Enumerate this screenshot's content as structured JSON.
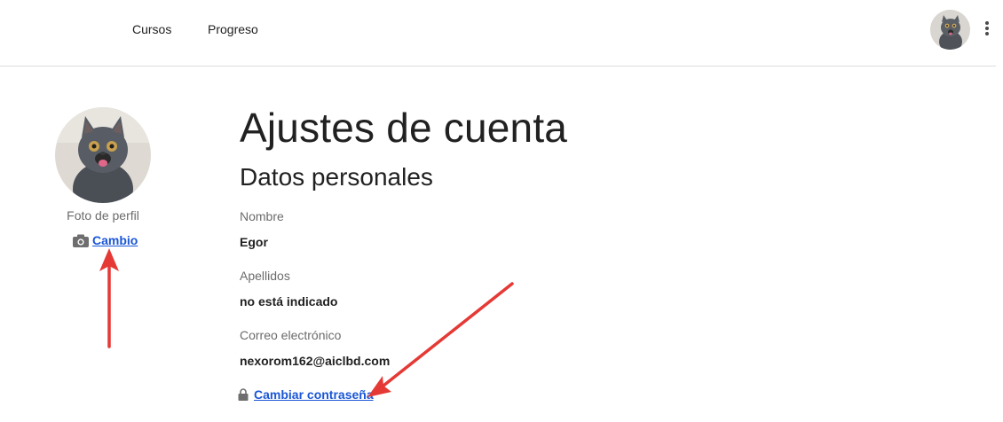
{
  "nav": {
    "courses": "Cursos",
    "progress": "Progreso",
    "user_avatar_icon": "cat-avatar",
    "menu_icon": "kebab-menu-icon"
  },
  "profile": {
    "photo_caption": "Foto de perfil",
    "change_label": "Cambio",
    "camera_icon": "camera-icon"
  },
  "main": {
    "title": "Ajustes de cuenta",
    "subtitle": "Datos personales",
    "fields": [
      {
        "label": "Nombre",
        "value": "Egor"
      },
      {
        "label": "Apellidos",
        "value": "no está indicado"
      },
      {
        "label": "Correo electrónico",
        "value": "nexorom162@aiclbd.com"
      }
    ],
    "change_password_label": "Cambiar contraseña",
    "lock_icon": "lock-icon"
  },
  "colors": {
    "link": "#1a56d6",
    "annotation_arrow": "#e53935",
    "text": "#212121",
    "muted": "#6b6b6b"
  }
}
